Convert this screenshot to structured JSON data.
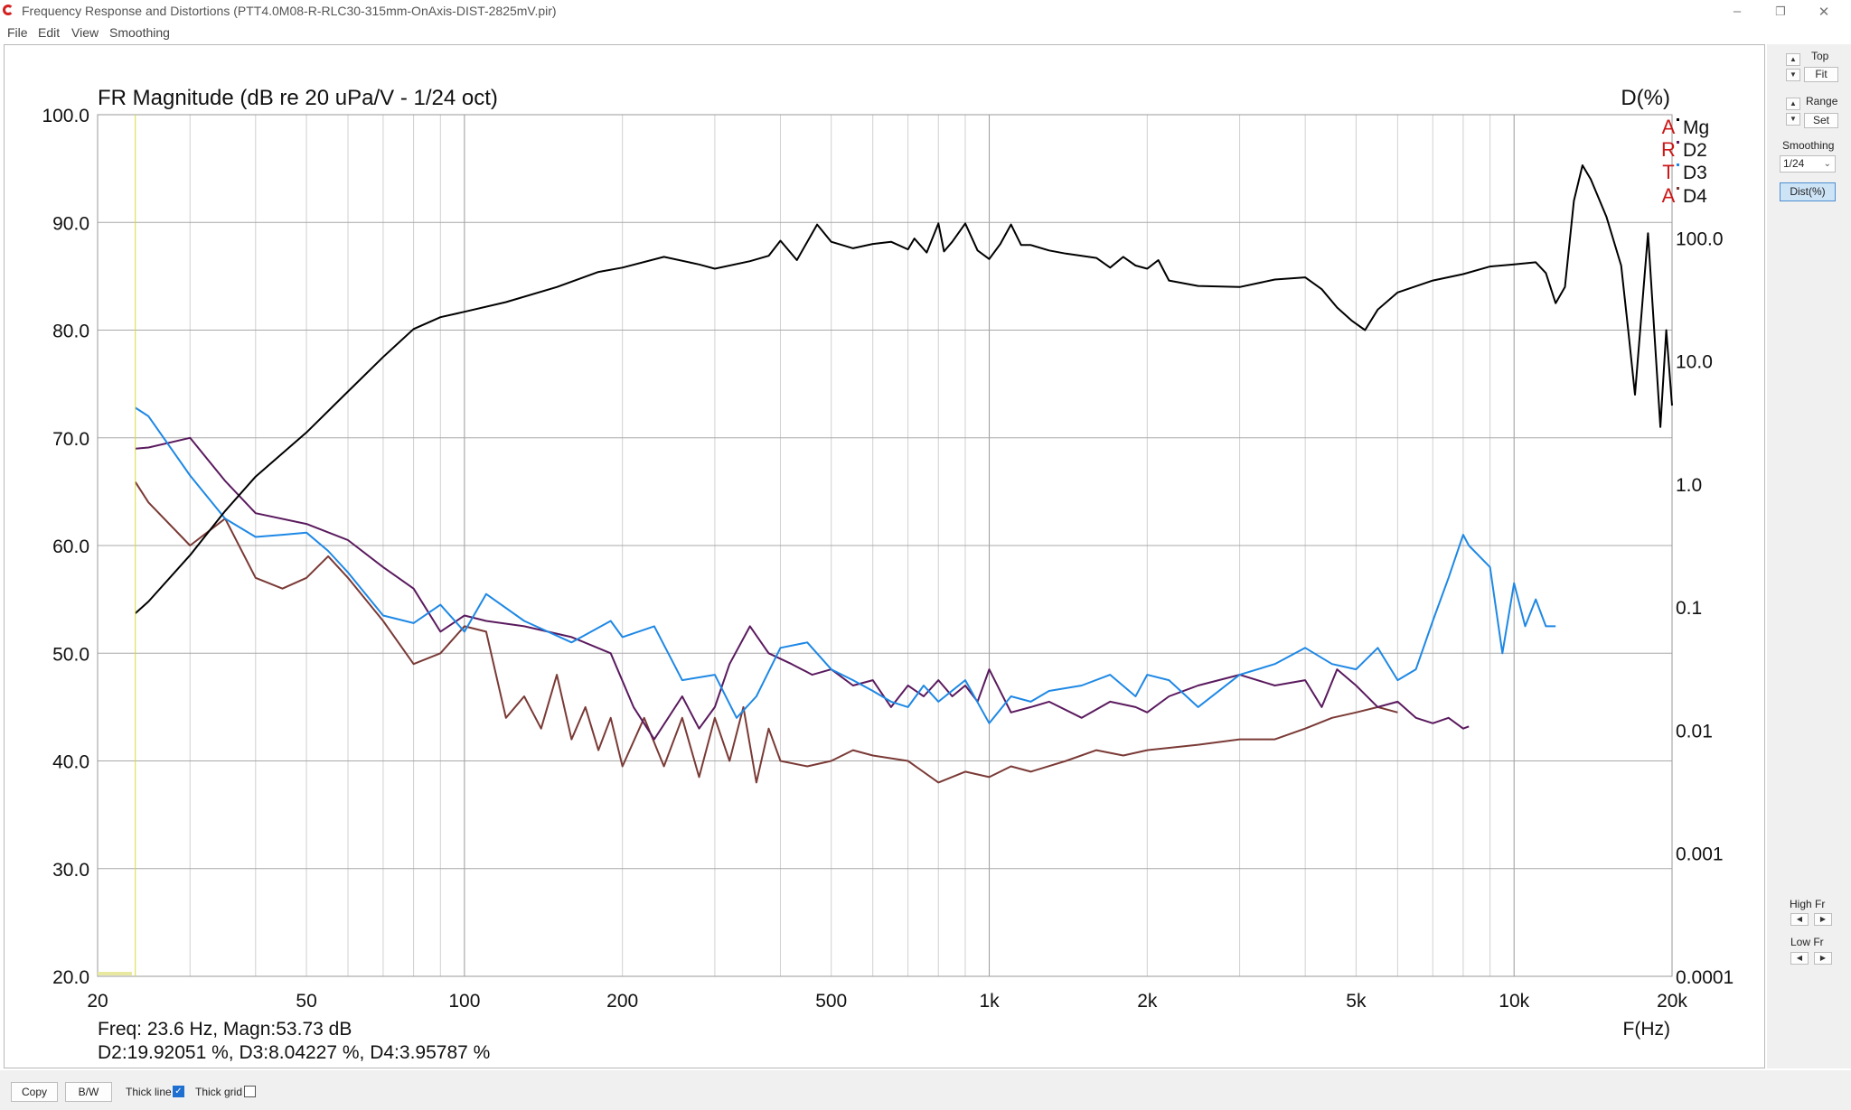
{
  "window": {
    "title": "Frequency Response and Distortions (PTT4.0M08-R-RLC30-315mm-OnAxis-DIST-2825mV.pir)",
    "minimize": "–",
    "restore": "❐",
    "close": "✕"
  },
  "menu": [
    "File",
    "Edit",
    "View",
    "Smoothing"
  ],
  "side_panel": {
    "top_label": "Top",
    "fit_label": "Fit",
    "range_label": "Range",
    "set_label": "Set",
    "smoothing_label": "Smoothing",
    "smoothing_value": "1/24",
    "dist_label": "Dist(%)",
    "high_fr_label": "High Fr",
    "low_fr_label": "Low Fr",
    "up_arrow": "▲",
    "down_arrow": "▼",
    "left_arrow": "◀",
    "right_arrow": "▶",
    "combo_arrow": "⌄"
  },
  "bottom_bar": {
    "copy_label": "Copy",
    "bw_label": "B/W",
    "thick_line_label": "Thick line",
    "thick_line_checked": true,
    "thick_grid_label": "Thick grid",
    "thick_grid_checked": false,
    "check_mark": "✓"
  },
  "colors": {
    "mg": "#000000",
    "d2": "#5a1a5e",
    "d3": "#1e88e5",
    "d4": "#7a3a36",
    "cursor": "#d8d840",
    "artа": "#cc1818"
  },
  "chart_data": {
    "type": "line",
    "title": "FR Magnitude (dB re 20 uPa/V - 1/24 oct)",
    "right_title": "D(%)",
    "xlabel": "F(Hz)",
    "x_scale": "log",
    "xlim": [
      20,
      20000
    ],
    "ylim": [
      20,
      100
    ],
    "y2_scale": "log",
    "y2lim": [
      0.0001,
      1000
    ],
    "x_ticks": [
      {
        "v": 20,
        "label": "20"
      },
      {
        "v": 50,
        "label": "50"
      },
      {
        "v": 100,
        "label": "100"
      },
      {
        "v": 200,
        "label": "200"
      },
      {
        "v": 500,
        "label": "500"
      },
      {
        "v": 1000,
        "label": "1k"
      },
      {
        "v": 2000,
        "label": "2k"
      },
      {
        "v": 5000,
        "label": "5k"
      },
      {
        "v": 10000,
        "label": "10k"
      },
      {
        "v": 20000,
        "label": "20k"
      }
    ],
    "y_ticks": [
      "100.0",
      "90.0",
      "80.0",
      "70.0",
      "60.0",
      "50.0",
      "40.0",
      "30.0",
      "20.0"
    ],
    "y2_ticks": [
      {
        "v": 100,
        "label": "100.0"
      },
      {
        "v": 10,
        "label": "10.0"
      },
      {
        "v": 1,
        "label": "1.0"
      },
      {
        "v": 0.1,
        "label": "0.1"
      },
      {
        "v": 0.01,
        "label": "0.01"
      },
      {
        "v": 0.001,
        "label": "0.001"
      },
      {
        "v": 0.0001,
        "label": "0.0001"
      }
    ],
    "cursor_x": 23.6,
    "readout_line1": "Freq: 23.6 Hz, Magn:53.73 dB",
    "readout_line2": "D2:19.92051 %, D3:8.04227 %, D4:3.95787 %",
    "arta_letters": [
      "A",
      "R",
      "T",
      "A"
    ],
    "series": [
      {
        "name": "Mg",
        "x": [
          23.6,
          25,
          30,
          35,
          40,
          50,
          60,
          70,
          80,
          90,
          100,
          120,
          150,
          180,
          200,
          240,
          280,
          300,
          350,
          380,
          400,
          430,
          470,
          500,
          550,
          600,
          650,
          700,
          720,
          760,
          800,
          820,
          850,
          900,
          950,
          1000,
          1050,
          1100,
          1150,
          1200,
          1300,
          1400,
          1500,
          1600,
          1700,
          1800,
          1900,
          2000,
          2100,
          2200,
          2500,
          3000,
          3500,
          4000,
          4300,
          4600,
          4900,
          5200,
          5500,
          6000,
          7000,
          8000,
          9000,
          10000,
          11000,
          11500,
          12000,
          12500,
          13000,
          13500,
          14000,
          15000,
          16000,
          16500,
          17000,
          18000,
          19000,
          19500,
          20000
        ],
        "y": [
          53.7,
          54.8,
          59.1,
          63.2,
          66.4,
          70.5,
          74.3,
          77.5,
          80.1,
          81.2,
          81.7,
          82.6,
          84.0,
          85.4,
          85.8,
          86.8,
          86.1,
          85.7,
          86.4,
          86.9,
          88.3,
          86.5,
          89.8,
          88.2,
          87.6,
          88.0,
          88.2,
          87.5,
          88.5,
          87.2,
          89.9,
          87.3,
          88.2,
          89.9,
          87.4,
          86.6,
          88.0,
          89.8,
          87.9,
          87.9,
          87.4,
          87.1,
          86.9,
          86.7,
          85.8,
          86.8,
          86.0,
          85.7,
          86.5,
          84.6,
          84.1,
          84.0,
          84.7,
          84.9,
          83.8,
          82.1,
          80.9,
          80.0,
          81.9,
          83.5,
          84.6,
          85.2,
          85.9,
          86.1,
          86.3,
          85.3,
          82.5,
          84.0,
          92.0,
          95.3,
          94.0,
          90.5,
          86.0,
          80.0,
          74.0,
          89.0,
          71.0,
          80.0,
          73.0
        ]
      },
      {
        "name": "D2",
        "x": [
          23.6,
          25,
          30,
          35,
          40,
          50,
          60,
          70,
          80,
          90,
          100,
          110,
          130,
          160,
          190,
          210,
          230,
          260,
          280,
          300,
          320,
          350,
          380,
          420,
          460,
          500,
          550,
          600,
          650,
          700,
          750,
          800,
          850,
          900,
          950,
          1000,
          1100,
          1200,
          1300,
          1500,
          1700,
          1900,
          2000,
          2200,
          2500,
          3000,
          3500,
          4000,
          4300,
          4600,
          5000,
          5500,
          6000,
          6500,
          7000,
          7500,
          8000,
          8200
        ],
        "y": [
          69.0,
          69.1,
          70.0,
          66.0,
          63.0,
          62.0,
          60.5,
          58.0,
          56.0,
          52.0,
          53.5,
          53.0,
          52.5,
          51.5,
          50.0,
          45.0,
          42.0,
          46.0,
          43.0,
          45.0,
          49.0,
          52.5,
          50.0,
          49.0,
          48.0,
          48.5,
          47.0,
          47.5,
          45.0,
          47.0,
          46.0,
          47.5,
          46.0,
          47.0,
          45.5,
          48.5,
          44.5,
          45.0,
          45.5,
          44.0,
          45.5,
          45.0,
          44.5,
          46.0,
          47.0,
          48.0,
          47.0,
          47.5,
          45.0,
          48.5,
          47.0,
          45.0,
          45.5,
          44.0,
          43.5,
          44.0,
          43.0,
          43.2
        ]
      },
      {
        "name": "D3",
        "x": [
          23.6,
          25,
          30,
          35,
          40,
          45,
          50,
          55,
          60,
          70,
          80,
          90,
          100,
          110,
          130,
          160,
          190,
          200,
          230,
          260,
          300,
          330,
          360,
          400,
          450,
          500,
          550,
          600,
          650,
          700,
          750,
          800,
          900,
          1000,
          1100,
          1200,
          1300,
          1500,
          1700,
          1900,
          2000,
          2200,
          2500,
          3000,
          3500,
          4000,
          4500,
          5000,
          5500,
          6000,
          6500,
          7000,
          7500,
          8000,
          8200,
          9000,
          9500,
          10000,
          10500,
          11000,
          11500,
          12000
        ],
        "y": [
          72.8,
          72.0,
          66.5,
          62.5,
          60.8,
          61.0,
          61.2,
          59.5,
          57.5,
          53.5,
          52.8,
          54.5,
          52.0,
          55.5,
          53.0,
          51.0,
          53.0,
          51.5,
          52.5,
          47.5,
          48.0,
          44.0,
          46.0,
          50.5,
          51.0,
          48.5,
          47.5,
          46.5,
          45.5,
          45.0,
          47.0,
          45.5,
          47.5,
          43.5,
          46.0,
          45.5,
          46.5,
          47.0,
          48.0,
          46.0,
          48.0,
          47.5,
          45.0,
          48.0,
          49.0,
          50.5,
          49.0,
          48.5,
          50.5,
          47.5,
          48.5,
          53.0,
          57.0,
          61.0,
          60.0,
          58.0,
          50.0,
          56.5,
          52.5,
          55.0,
          52.5,
          52.5
        ]
      },
      {
        "name": "D4",
        "x": [
          23.6,
          25,
          30,
          35,
          40,
          45,
          50,
          55,
          60,
          70,
          80,
          90,
          100,
          110,
          120,
          130,
          140,
          150,
          160,
          170,
          180,
          190,
          200,
          220,
          240,
          260,
          280,
          300,
          320,
          340,
          360,
          380,
          400,
          450,
          500,
          550,
          600,
          700,
          800,
          900,
          1000,
          1100,
          1200,
          1400,
          1600,
          1800,
          2000,
          2500,
          3000,
          3500,
          4000,
          4500,
          5000,
          5500,
          6000
        ],
        "y": [
          65.9,
          64.0,
          60.0,
          62.5,
          57.0,
          56.0,
          57.0,
          59.0,
          57.0,
          53.0,
          49.0,
          50.0,
          52.5,
          52.0,
          44.0,
          46.0,
          43.0,
          48.0,
          42.0,
          45.0,
          41.0,
          44.0,
          39.5,
          44.0,
          39.5,
          44.0,
          38.5,
          44.0,
          40.0,
          45.0,
          38.0,
          43.0,
          40.0,
          39.5,
          40.0,
          41.0,
          40.5,
          40.0,
          38.0,
          39.0,
          38.5,
          39.5,
          39.0,
          40.0,
          41.0,
          40.5,
          41.0,
          41.5,
          42.0,
          42.0,
          43.0,
          44.0,
          44.5,
          45.0,
          44.5
        ]
      }
    ]
  }
}
